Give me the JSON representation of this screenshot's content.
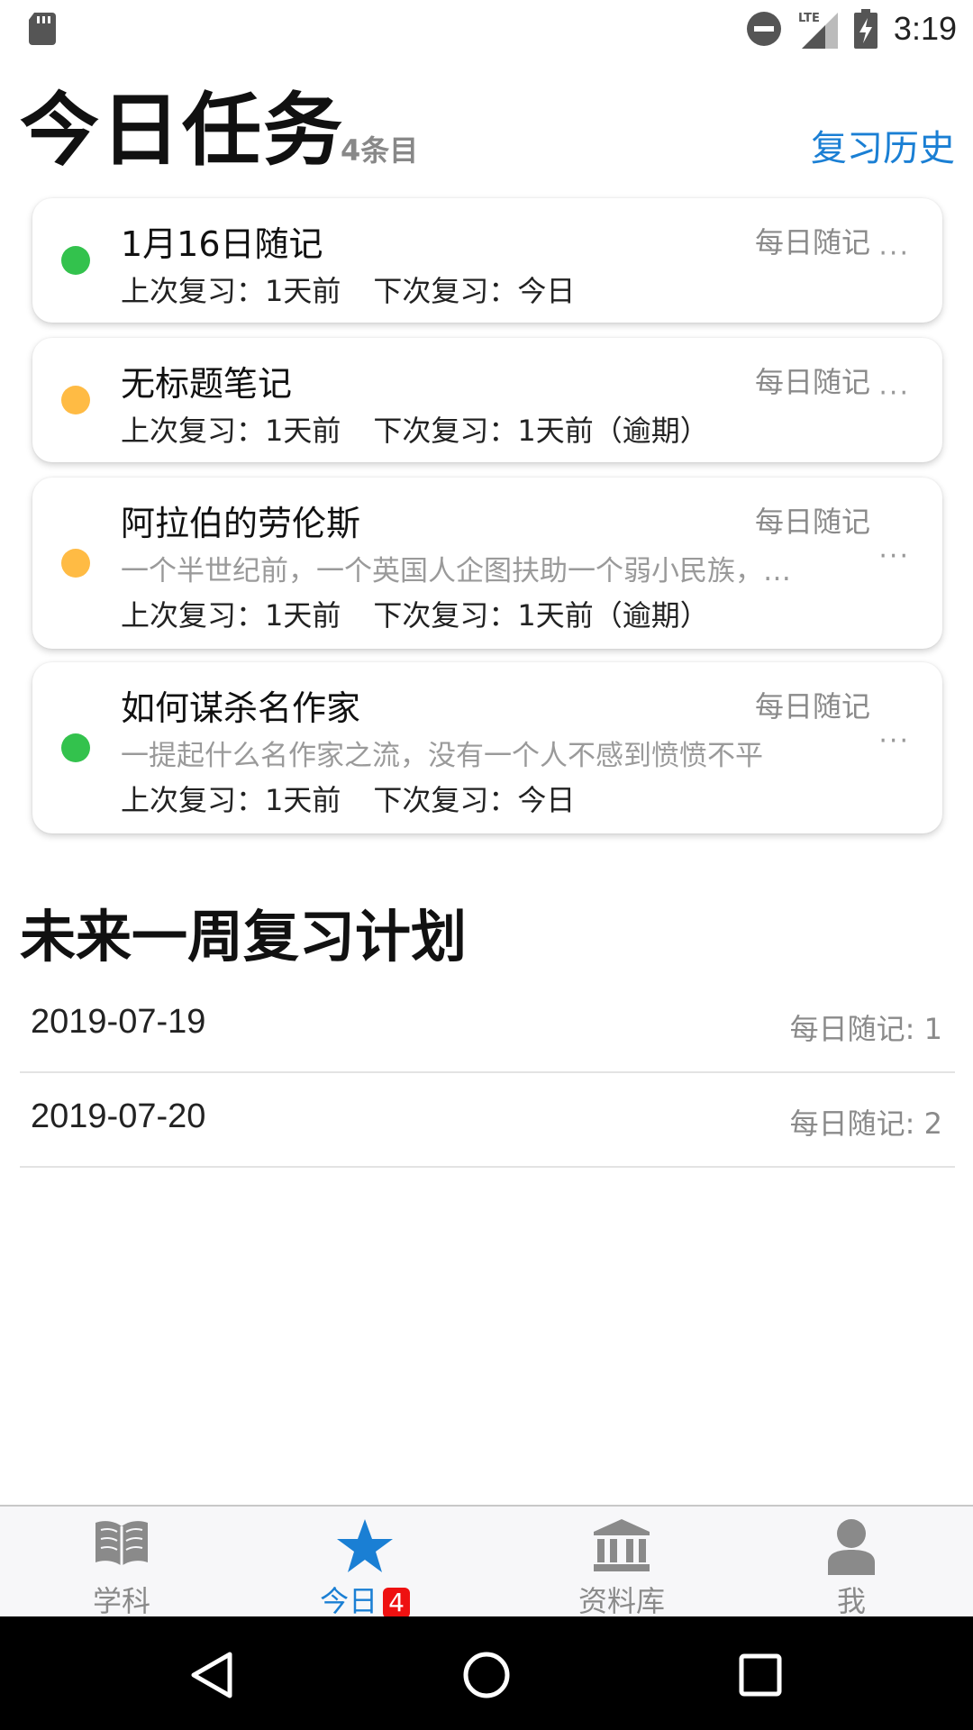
{
  "status_bar": {
    "time": "3:19",
    "network": "LTE"
  },
  "header": {
    "title": "今日任务",
    "count": "4条目",
    "history_link": "复习历史"
  },
  "tasks": [
    {
      "title": "1月16日随记",
      "category": "每日随记",
      "excerpt": "",
      "last_review": "上次复习：1天前",
      "next_review": "下次复习：今日",
      "status": "due",
      "status_color": "#33c24d"
    },
    {
      "title": "无标题笔记",
      "category": "每日随记",
      "excerpt": "",
      "last_review": "上次复习：1天前",
      "next_review": "下次复习：1天前（逾期）",
      "status": "overdue",
      "status_color": "#ffbb44"
    },
    {
      "title": "阿拉伯的劳伦斯",
      "category": "每日随记",
      "excerpt": "一个半世纪前，一个英国人企图扶助一个弱小民族，…",
      "last_review": "上次复习：1天前",
      "next_review": "下次复习：1天前（逾期）",
      "status": "overdue",
      "status_color": "#ffbb44"
    },
    {
      "title": "如何谋杀名作家",
      "category": "每日随记",
      "excerpt": "一提起什么名作家之流，没有一个人不感到愤愤不平",
      "last_review": "上次复习：1天前",
      "next_review": "下次复习：今日",
      "status": "due",
      "status_color": "#33c24d"
    }
  ],
  "plan": {
    "title": "未来一周复习计划",
    "rows": [
      {
        "date": "2019-07-19",
        "count": "每日随记: 1"
      },
      {
        "date": "2019-07-20",
        "count": "每日随记: 2"
      }
    ]
  },
  "tabbar": {
    "items": [
      {
        "label": "学科",
        "icon": "book-icon",
        "active": false
      },
      {
        "label": "今日",
        "icon": "star-icon",
        "active": true,
        "badge": "4"
      },
      {
        "label": "资料库",
        "icon": "library-icon",
        "active": false
      },
      {
        "label": "我",
        "icon": "person-icon",
        "active": false
      }
    ]
  },
  "colors": {
    "accent": "#1a7fd4",
    "due": "#33c24d",
    "overdue": "#ffbb44",
    "badge": "#ee1111"
  }
}
